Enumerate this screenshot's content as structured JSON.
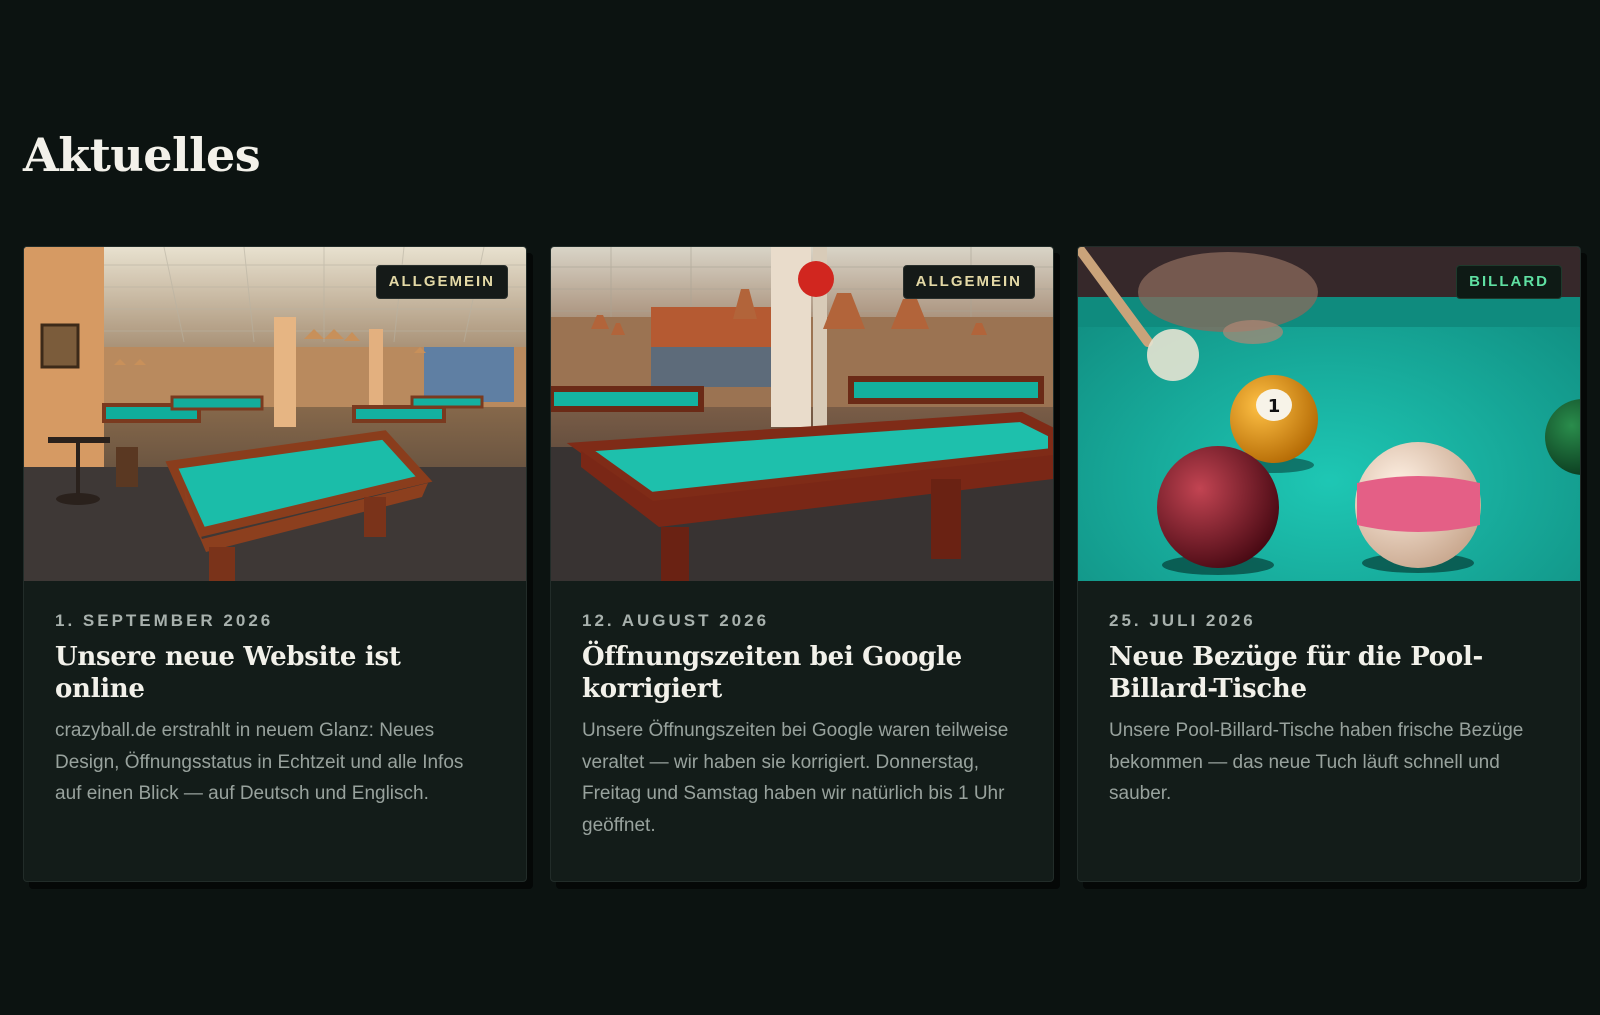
{
  "section": {
    "title": "Aktuelles"
  },
  "posts": [
    {
      "category": "ALLGEMEIN",
      "date": "1. SEPTEMBER 2026",
      "title": "Unsere neue Website ist online",
      "excerpt": "crazyball.de erstrahlt in neuem Glanz: Neues Design, Öffnungsstatus in Echtzeit und alle Infos auf einen Blick — auf Deutsch und Englisch.",
      "image": "billiard-hall-photo"
    },
    {
      "category": "ALLGEMEIN",
      "date": "12. AUGUST 2026",
      "title": "Öffnungszeiten bei Google korrigiert",
      "excerpt": "Unsere Öffnungszeiten bei Google waren teilweise veraltet — wir haben sie korrigiert. Donnerstag, Freitag und Samstag haben wir natürlich bis 1 Uhr geöffnet.",
      "image": "billiard-table-closeup-photo"
    },
    {
      "category": "BILLARD",
      "date": "25. JULI 2026",
      "title": "Neue Bezüge für die Pool-Billard-Tische",
      "excerpt": "Unsere Pool-Billard-Tische haben frische Bezüge bekommen — das neue Tuch läuft schnell und sauber.",
      "image": "pool-balls-photo"
    }
  ],
  "colors": {
    "background": "#0c1311",
    "card": "#131c19",
    "felt": "#1fb3a2",
    "badge_general": "#e4d9a6",
    "badge_billard": "#5fe0a2"
  }
}
